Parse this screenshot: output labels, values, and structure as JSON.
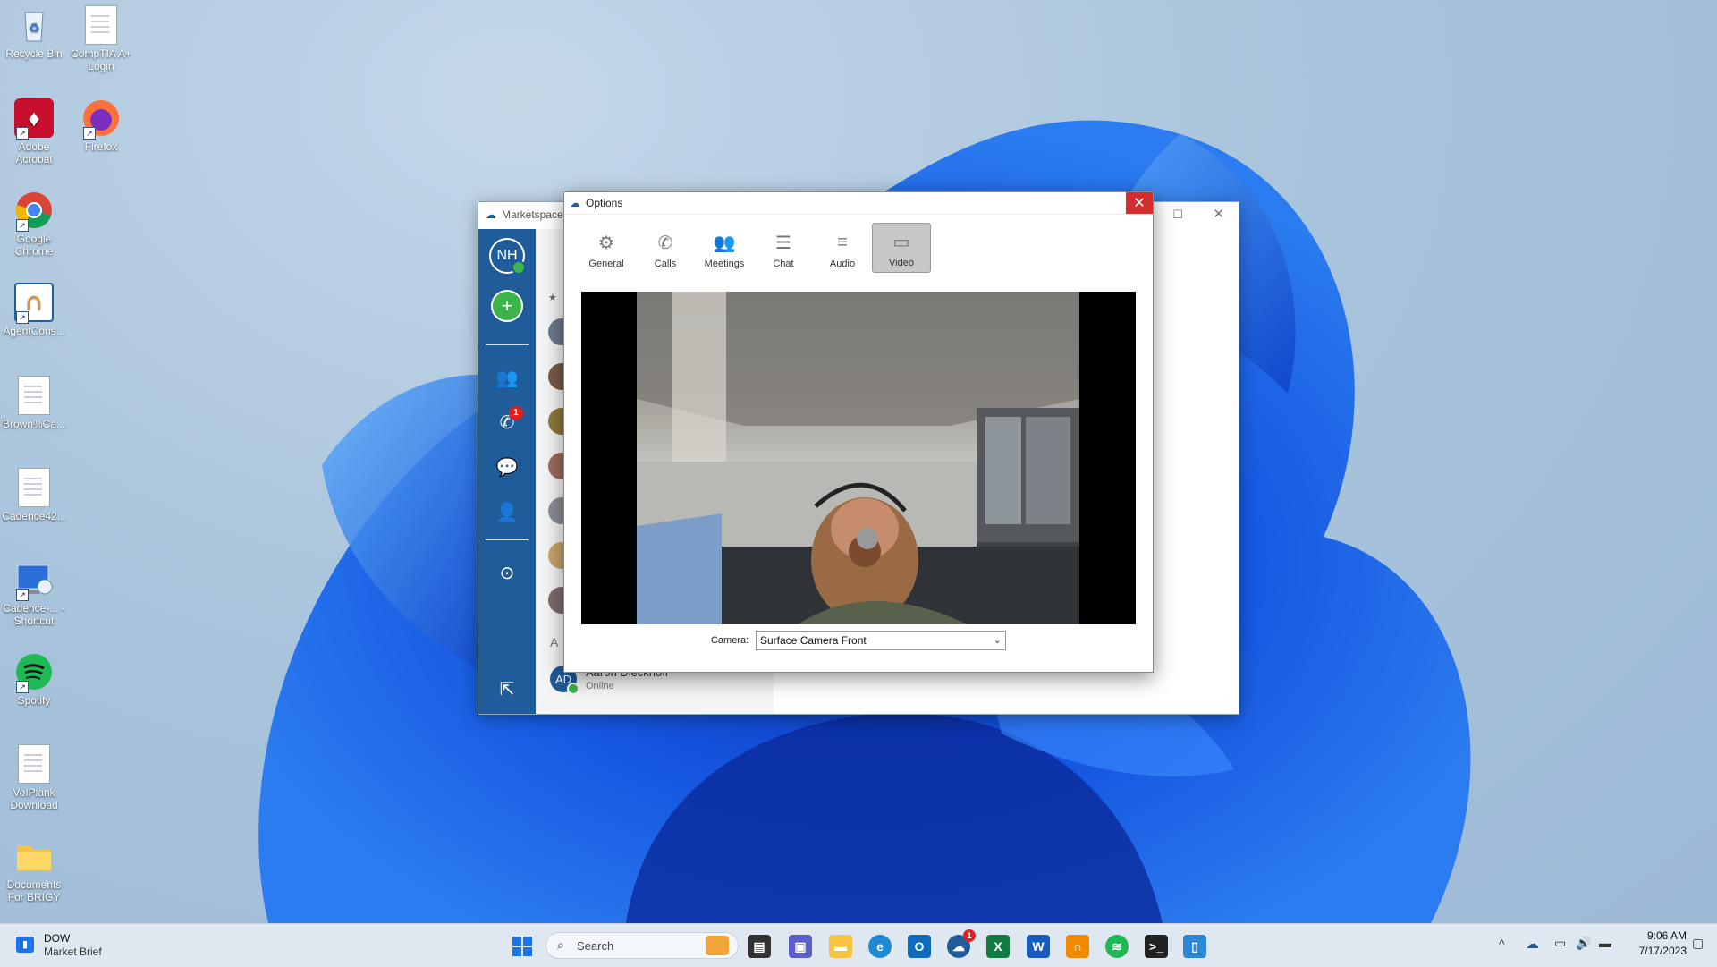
{
  "desktop": {
    "icons": [
      {
        "label": "Recycle Bin",
        "kind": "recycle"
      },
      {
        "label": "CompTIA A+ Login",
        "kind": "file"
      },
      {
        "label": "Adobe Acrobat",
        "kind": "acrobat"
      },
      {
        "label": "Firefox",
        "kind": "firefox"
      },
      {
        "label": "Google Chrome",
        "kind": "chrome"
      },
      {
        "label": "AgentCons...",
        "kind": "agentconsole"
      },
      {
        "label": "Brown%Ca...",
        "kind": "file"
      },
      {
        "label": "Cadence42...",
        "kind": "file"
      },
      {
        "label": "Cadence-... - Shortcut",
        "kind": "remote"
      },
      {
        "label": "Spotify",
        "kind": "spotify"
      },
      {
        "label": "VoIPlank Download",
        "kind": "file"
      },
      {
        "label": "Documents For BRIGY",
        "kind": "folder"
      }
    ]
  },
  "marketspace": {
    "title": "Marketspace",
    "avatar_initials": "NH",
    "calls_badge": "1",
    "section_letter": "A",
    "contact": {
      "initials": "AD",
      "name": "Aaron Dieckhoff",
      "status": "Online"
    }
  },
  "options": {
    "title": "Options",
    "close_symbol": "✕",
    "tabs": [
      {
        "label": "General",
        "icon": "gear-icon"
      },
      {
        "label": "Calls",
        "icon": "phone-icon"
      },
      {
        "label": "Meetings",
        "icon": "meetings-icon"
      },
      {
        "label": "Chat",
        "icon": "chat-icon"
      },
      {
        "label": "Audio",
        "icon": "sliders-icon"
      },
      {
        "label": "Video",
        "icon": "video-camera-icon"
      }
    ],
    "active_tab": "Video",
    "camera_label": "Camera:",
    "camera_value": "Surface Camera Front"
  },
  "taskbar": {
    "widget_title": "DOW",
    "widget_subtitle": "Market Brief",
    "search_placeholder": "Search",
    "onedrive_badge": "1",
    "time": "9:06 AM",
    "date": "7/17/2023"
  },
  "colors": {
    "rail": "#1f5c99",
    "close": "#d32f2f",
    "accent": "#1a73e8"
  }
}
